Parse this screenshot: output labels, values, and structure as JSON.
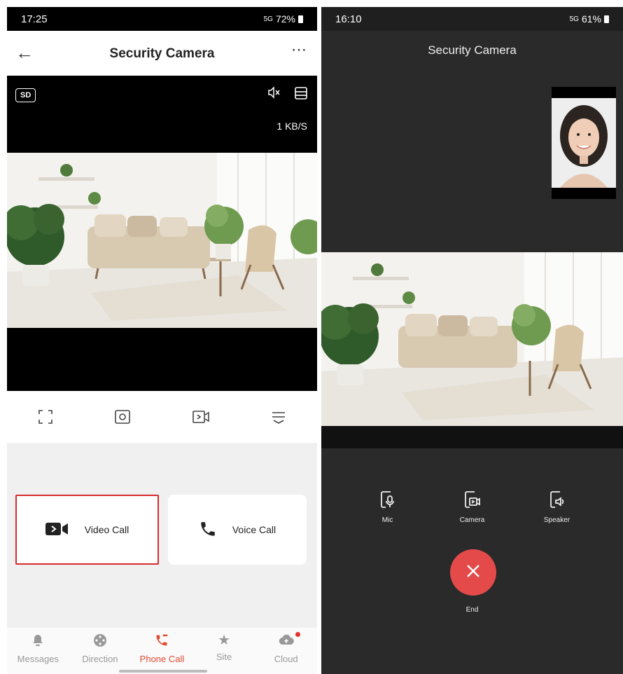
{
  "left_screen": {
    "status": {
      "time": "17:25",
      "signal": "5G",
      "battery": "72%"
    },
    "header": {
      "title": "Security Camera"
    },
    "stream": {
      "quality": "SD",
      "speed": "1 KB/S"
    },
    "calls": {
      "video_label": "Video Call",
      "voice_label": "Voice Call"
    },
    "tabs": [
      {
        "label": "Messages"
      },
      {
        "label": "Direction"
      },
      {
        "label": "Phone Call"
      },
      {
        "label": "Site"
      },
      {
        "label": "Cloud"
      }
    ],
    "active_tab": "Phone Call",
    "colors": {
      "accent": "#e14a2f",
      "highlight_border": "#d72b2b"
    }
  },
  "right_screen": {
    "status": {
      "time": "16:10",
      "signal": "5G",
      "battery": "61%"
    },
    "title": "Security Camera",
    "controls": [
      {
        "label": "Mic"
      },
      {
        "label": "Camera"
      },
      {
        "label": "Speaker"
      }
    ],
    "end_label": "End",
    "colors": {
      "end_button": "#e44a4a"
    }
  }
}
